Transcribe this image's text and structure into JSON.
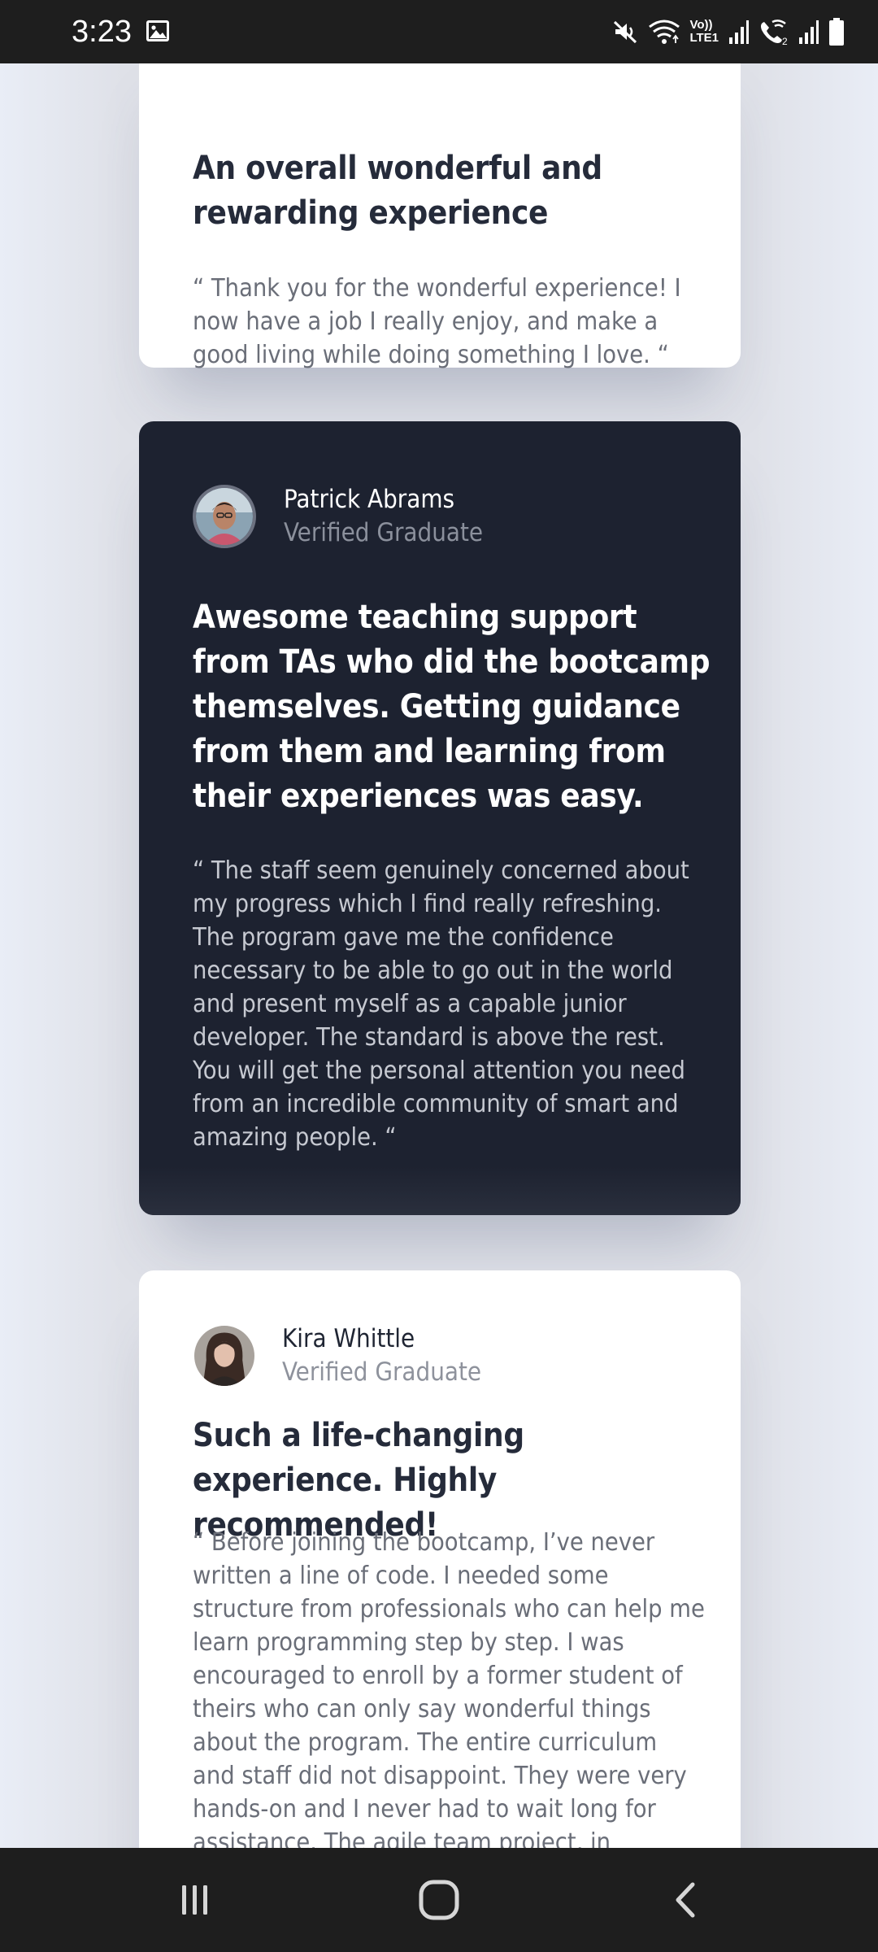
{
  "status_bar": {
    "time": "3:23",
    "volte_label_top": "Vo))",
    "volte_label_bottom": "LTE1",
    "sim2_label": "2",
    "icons": [
      "gallery-icon",
      "mute-icon",
      "wifi-icon",
      "volte-icon",
      "signal-icon",
      "wifi-calling-icon",
      "signal-icon",
      "battery-icon"
    ]
  },
  "testimonials": [
    {
      "headline": "An overall wonderful and rewarding experience",
      "quote": "“ Thank you for the wonderful experience! I now have a job I really enjoy, and make a good living while doing something I love. “",
      "theme": "light"
    },
    {
      "name": "Patrick Abrams",
      "status": "Verified Graduate",
      "headline": "Awesome teaching support from TAs who did the bootcamp themselves. Getting guidance from them and learning from their experiences was easy.",
      "quote": "“ The staff seem genuinely concerned about my progress which I find really refreshing. The program gave me the confidence necessary to be able to go out in the world and present myself as a capable junior developer. The standard is above the rest. You will get the personal attention you need from an incredible community of smart and amazing people. “",
      "theme": "dark"
    },
    {
      "name": "Kira Whittle",
      "status": "Verified Graduate",
      "headline": "Such a life-changing experience. Highly recommended!",
      "quote": "“ Before joining the bootcamp, I’ve never written a line of code. I needed some structure from professionals who can help me learn programming step by step. I was encouraged to enroll by a former student of theirs who can only say wonderful things about the program. The entire curriculum and staff did not disappoint. They were very hands-on and I never had to wait long for assistance. The agile team project, in",
      "theme": "light"
    }
  ],
  "nav_bar": {
    "buttons": [
      "recent-apps-icon",
      "home-icon",
      "back-icon"
    ]
  },
  "colors": {
    "dark_card": "#1d2230",
    "light_card": "#ffffff",
    "page_bg": "#dfe1e8"
  }
}
